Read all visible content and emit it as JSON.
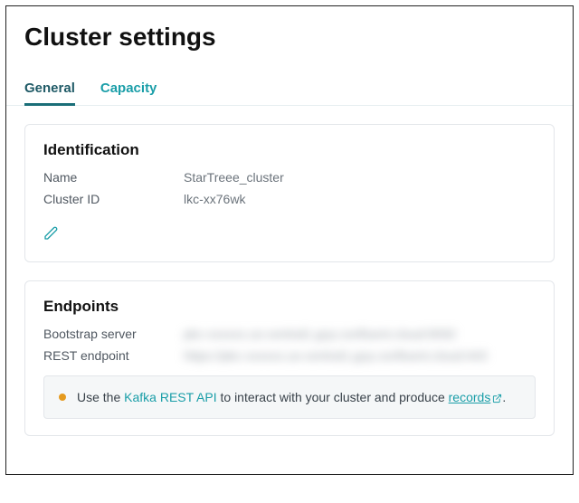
{
  "page": {
    "title": "Cluster settings"
  },
  "tabs": [
    {
      "id": "general",
      "label": "General",
      "active": true
    },
    {
      "id": "capacity",
      "label": "Capacity",
      "active": false
    }
  ],
  "identification": {
    "heading": "Identification",
    "name_label": "Name",
    "name_value": "StarTreee_cluster",
    "cluster_id_label": "Cluster ID",
    "cluster_id_value": "lkc-xx76wk"
  },
  "endpoints": {
    "heading": "Endpoints",
    "bootstrap_label": "Bootstrap server",
    "bootstrap_value": "pkc-xxxxxx.us-central1.gcp.confluent.cloud:9092",
    "rest_label": "REST endpoint",
    "rest_value": "https://pkc-xxxxxx.us-central1.gcp.confluent.cloud:443",
    "notice_pre": "Use the ",
    "notice_link1": "Kafka REST API",
    "notice_mid": " to interact with your cluster and produce ",
    "notice_link2": "records",
    "notice_post": "."
  }
}
